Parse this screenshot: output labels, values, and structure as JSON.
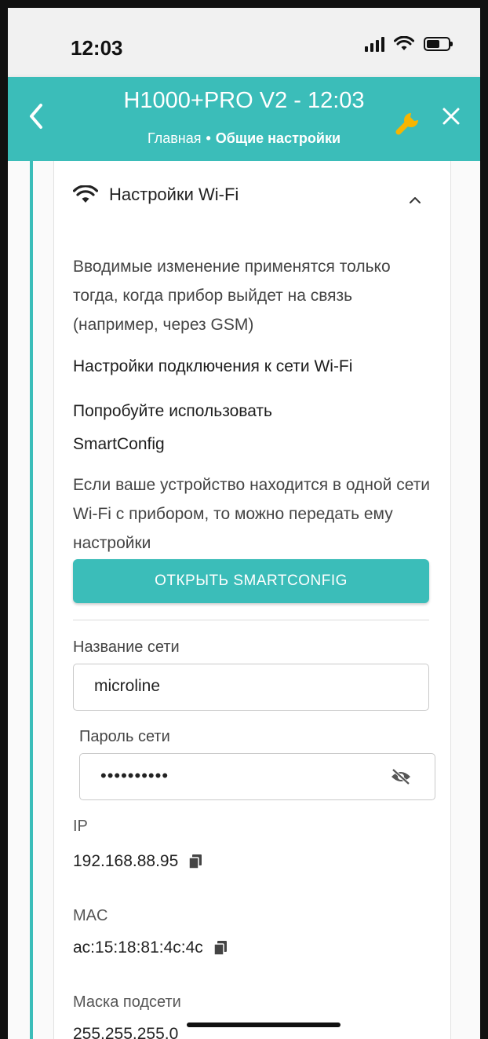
{
  "status_bar": {
    "time": "12:03"
  },
  "header": {
    "title": "H1000+PRO V2 - 12:03",
    "breadcrumb": {
      "home": "Главная",
      "separator": "•",
      "current": "Общие настройки"
    },
    "accent_color": "#3bbdb9"
  },
  "section": {
    "title": "Настройки Wi-Fi",
    "icon": "wifi-icon",
    "note": "Вводимые изменение применятся только тогда, когда прибор выйдет на связь (например, через GSM)",
    "subtitle": "Настройки подключения к сети Wi-Fi",
    "smartconfig_prompt_1": "Попробуйте использовать",
    "smartconfig_prompt_2": "SmartConfig",
    "smartconfig_desc": "Если ваше устройство находится в одной сети Wi-Fi с прибором, то можно передать ему настройки",
    "smartconfig_button": "ОТКРЫТЬ SMARTCONFIG"
  },
  "form": {
    "network_name_label": "Название сети",
    "network_name_value": "microline",
    "password_label": "Пароль сети",
    "password_value": "••••••••••"
  },
  "info": {
    "ip_label": "IP",
    "ip_value": "192.168.88.95",
    "mac_label": "MAC",
    "mac_value": "ac:15:18:81:4c:4c",
    "mask_label": "Маска подсети",
    "mask_value": "255.255.255.0"
  }
}
